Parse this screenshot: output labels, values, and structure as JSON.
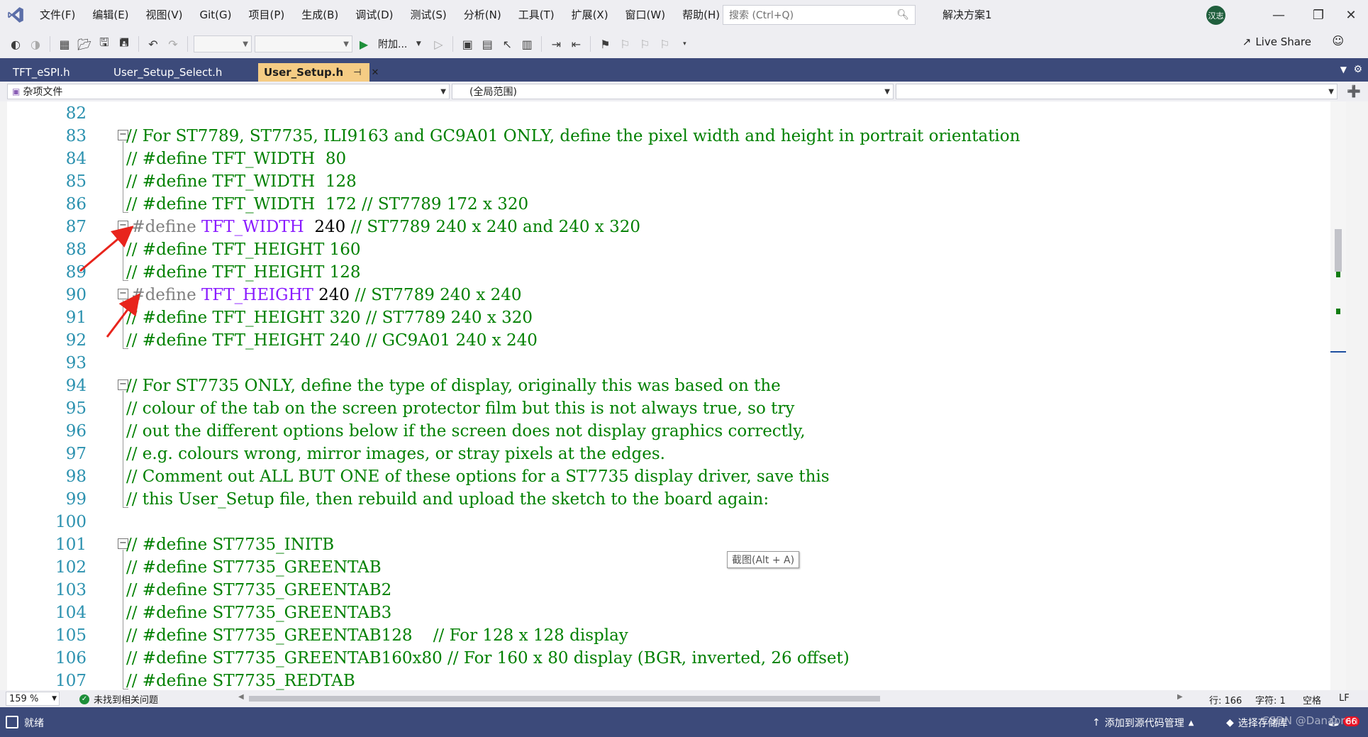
{
  "menu": {
    "items": [
      "文件(F)",
      "编辑(E)",
      "视图(V)",
      "Git(G)",
      "项目(P)",
      "生成(B)",
      "调试(D)",
      "测试(S)",
      "分析(N)",
      "工具(T)",
      "扩展(X)",
      "窗口(W)",
      "帮助(H)"
    ]
  },
  "search": {
    "placeholder": "搜索 (Ctrl+Q)"
  },
  "solution_name": "解决方案1",
  "avatar_text": "汉志",
  "toolbar": {
    "attach_label": "附加...",
    "live_share": "Live Share"
  },
  "tabs": [
    {
      "label": "TFT_eSPI.h"
    },
    {
      "label": "User_Setup_Select.h"
    },
    {
      "label": "User_Setup.h"
    }
  ],
  "navbar": {
    "project": "杂项文件",
    "scope": "(全局范围)"
  },
  "editor": {
    "lines": [
      {
        "n": "82",
        "segs": []
      },
      {
        "n": "83",
        "segs": [
          [
            "c",
            "// For ST7789, ST7735, ILI9163 and GC9A01 ONLY, define the pixel width and height in portrait orientation"
          ]
        ]
      },
      {
        "n": "84",
        "segs": [
          [
            "c",
            "// #define TFT_WIDTH  80"
          ]
        ]
      },
      {
        "n": "85",
        "segs": [
          [
            "c",
            "// #define TFT_WIDTH  128"
          ]
        ]
      },
      {
        "n": "86",
        "segs": [
          [
            "c",
            "// #define TFT_WIDTH  172 // ST7789 172 x 320"
          ]
        ]
      },
      {
        "n": "87",
        "segs": [
          [
            "pp",
            " #define "
          ],
          [
            "mac",
            "TFT_WIDTH"
          ],
          [
            "plain",
            "  240 "
          ],
          [
            "c",
            "// ST7789 240 x 240 and 240 x 320"
          ]
        ]
      },
      {
        "n": "88",
        "segs": [
          [
            "c",
            "// #define TFT_HEIGHT 160"
          ]
        ]
      },
      {
        "n": "89",
        "segs": [
          [
            "c",
            "// #define TFT_HEIGHT 128"
          ]
        ]
      },
      {
        "n": "90",
        "segs": [
          [
            "pp",
            " #define "
          ],
          [
            "mac",
            "TFT_HEIGHT"
          ],
          [
            "plain",
            " 240 "
          ],
          [
            "c",
            "// ST7789 240 x 240"
          ]
        ]
      },
      {
        "n": "91",
        "segs": [
          [
            "c",
            "// #define TFT_HEIGHT 320 // ST7789 240 x 320"
          ]
        ]
      },
      {
        "n": "92",
        "segs": [
          [
            "c",
            "// #define TFT_HEIGHT 240 // GC9A01 240 x 240"
          ]
        ]
      },
      {
        "n": "93",
        "segs": []
      },
      {
        "n": "94",
        "segs": [
          [
            "c",
            "// For ST7735 ONLY, define the type of display, originally this was based on the"
          ]
        ]
      },
      {
        "n": "95",
        "segs": [
          [
            "c",
            "// colour of the tab on the screen protector film but this is not always true, so try"
          ]
        ]
      },
      {
        "n": "96",
        "segs": [
          [
            "c",
            "// out the different options below if the screen does not display graphics correctly,"
          ]
        ]
      },
      {
        "n": "97",
        "segs": [
          [
            "c",
            "// e.g. colours wrong, mirror images, or stray pixels at the edges."
          ]
        ]
      },
      {
        "n": "98",
        "segs": [
          [
            "c",
            "// Comment out ALL BUT ONE of these options for a ST7735 display driver, save this"
          ]
        ]
      },
      {
        "n": "99",
        "segs": [
          [
            "c",
            "// this User_Setup file, then rebuild and upload the sketch to the board again:"
          ]
        ]
      },
      {
        "n": "100",
        "segs": []
      },
      {
        "n": "101",
        "segs": [
          [
            "c",
            "// #define ST7735_INITB"
          ]
        ]
      },
      {
        "n": "102",
        "segs": [
          [
            "c",
            "// #define ST7735_GREENTAB"
          ]
        ]
      },
      {
        "n": "103",
        "segs": [
          [
            "c",
            "// #define ST7735_GREENTAB2"
          ]
        ]
      },
      {
        "n": "104",
        "segs": [
          [
            "c",
            "// #define ST7735_GREENTAB3"
          ]
        ]
      },
      {
        "n": "105",
        "segs": [
          [
            "c",
            "// #define ST7735_GREENTAB128    // For 128 x 128 display"
          ]
        ]
      },
      {
        "n": "106",
        "segs": [
          [
            "c",
            "// #define ST7735_GREENTAB160x80 // For 160 x 80 display (BGR, inverted, 26 offset)"
          ]
        ]
      },
      {
        "n": "107",
        "segs": [
          [
            "c",
            "// #define ST7735_REDTAB"
          ]
        ]
      }
    ]
  },
  "tooltip": "截图(Alt + A)",
  "editor_status": {
    "zoom": "159 %",
    "issues": "未找到相关问题",
    "line": "行: 166",
    "char": "字符: 1",
    "spaces": "空格",
    "eol": "LF"
  },
  "statusbar": {
    "ready": "就绪",
    "add_source": "添加到源代码管理",
    "select_repo": "选择存储库",
    "notification_count": "66"
  },
  "watermark": "CSDN @Danaoren",
  "colors": {
    "comment": "#008000",
    "macro": "#8a1bff",
    "line_number": "#2b91af",
    "tab_active": "#f5cc84",
    "chrome": "#3c4a7a",
    "arrow": "#e8241c"
  }
}
